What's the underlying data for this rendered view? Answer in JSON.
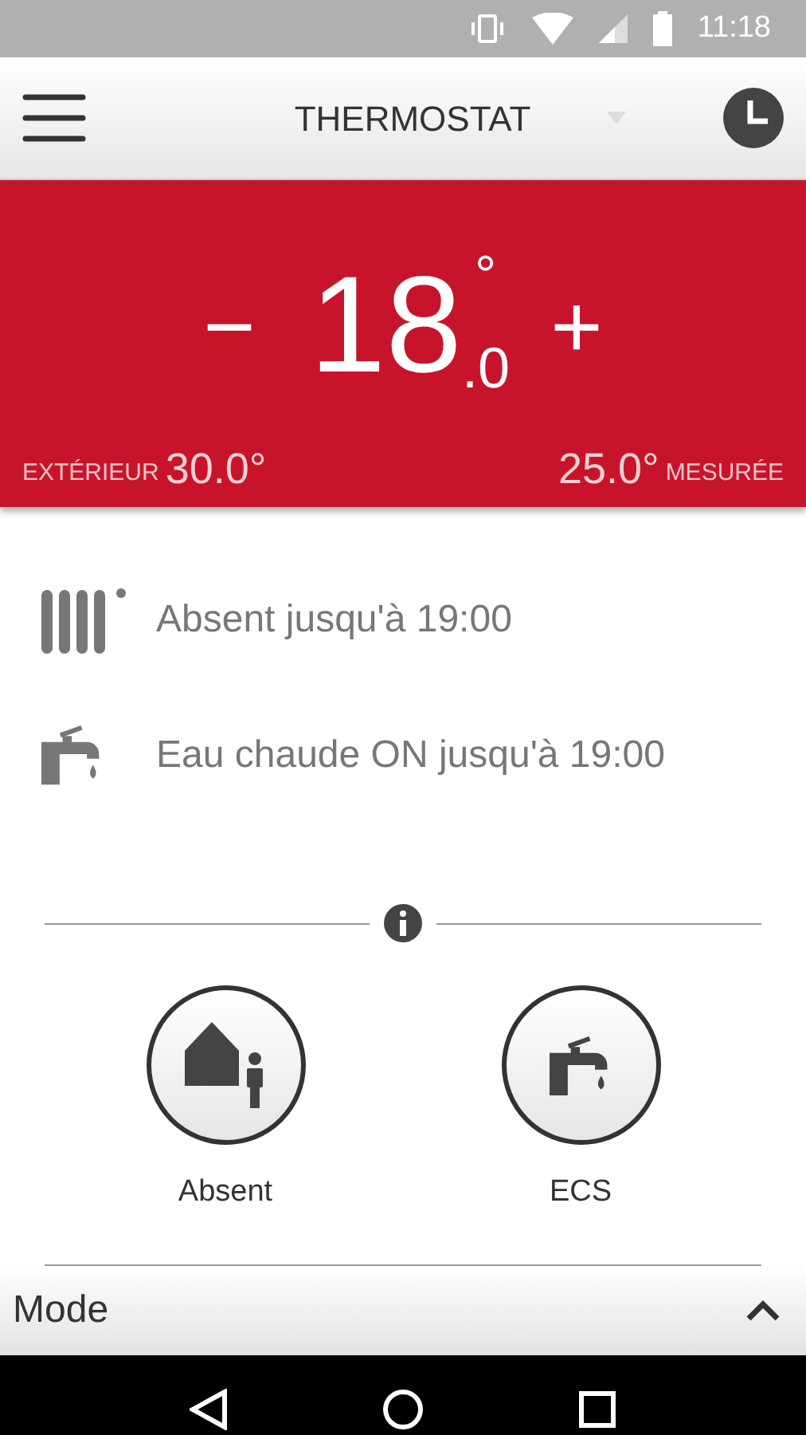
{
  "status_bar": {
    "time": "11:18"
  },
  "app_bar": {
    "title": "THERMOSTAT"
  },
  "setpoint": {
    "minus": "−",
    "integer": "18",
    "decimal": ".0",
    "degree": "°",
    "plus": "+"
  },
  "outdoor": {
    "label": "EXTÉRIEUR",
    "value": "30.0°"
  },
  "measured": {
    "value": "25.0°",
    "label": "MESURÉE"
  },
  "status_rows": [
    {
      "kind": "radiator",
      "text": "Absent jusqu'à 19:00"
    },
    {
      "kind": "tap",
      "text": "Eau chaude ON jusqu'à 19:00"
    }
  ],
  "mode_buttons": [
    {
      "kind": "away",
      "label": "Absent"
    },
    {
      "kind": "tap",
      "label": "ECS"
    }
  ],
  "mode_bar": {
    "title": "Mode",
    "expanded": true
  }
}
